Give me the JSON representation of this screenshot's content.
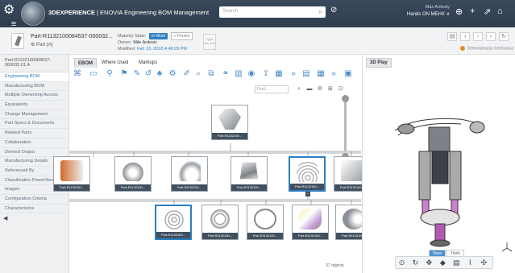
{
  "topbar": {
    "brand_bold": "3DEXPERIENCE",
    "brand_rest": " | ENOVIA  Engineering BOM Management",
    "search_placeholder": "Search",
    "user_name": "Max Ardesty",
    "user_role": "Hands ON MEHX ∨"
  },
  "header": {
    "part_title": "Part-R1132100084537-000032...",
    "part_type": "⚙ Part (A)",
    "maturity_label": "Maturity State:",
    "state_on": "In Work",
    "state_off": "» Frozen",
    "owner_label": "Owner:",
    "owner_value": "Mile Ardesic",
    "modified_label": "Modified:",
    "modified_value": "Feb 13, 2018 4:48:29 PM",
    "lock_text": "Type the text",
    "demo_text": "Demonstracija mechanica"
  },
  "sidebar": {
    "top": "Part-R1132100084537-000032.01.A",
    "items": [
      {
        "label": "Engineering BOM"
      },
      {
        "label": "Manufacturing BOM"
      },
      {
        "label": "Multiple Ownership Access"
      },
      {
        "label": "Equivalents"
      },
      {
        "label": "Change Management"
      },
      {
        "label": "Part Specs & Documents"
      },
      {
        "label": "Related Parts"
      },
      {
        "label": "Collaboration"
      },
      {
        "label": "Derived Output"
      },
      {
        "label": "Manufacturing Details"
      },
      {
        "label": "Referenced By"
      },
      {
        "label": "Classification PowerView"
      },
      {
        "label": "Images"
      },
      {
        "label": "Configuration Criteria"
      },
      {
        "label": "Characteristics"
      }
    ]
  },
  "main": {
    "tabs": [
      {
        "label": "EBOM"
      },
      {
        "label": "Where Used"
      },
      {
        "label": "Markups"
      }
    ],
    "find_placeholder": "Find...",
    "node_label": "Part-R1132100084537-000032...",
    "node_label_short": "Part-R1132100...",
    "objects_count": "37 objects"
  },
  "panel3d": {
    "tab": "3D Play",
    "view_tab": "View",
    "tools_tab": "Tools"
  }
}
